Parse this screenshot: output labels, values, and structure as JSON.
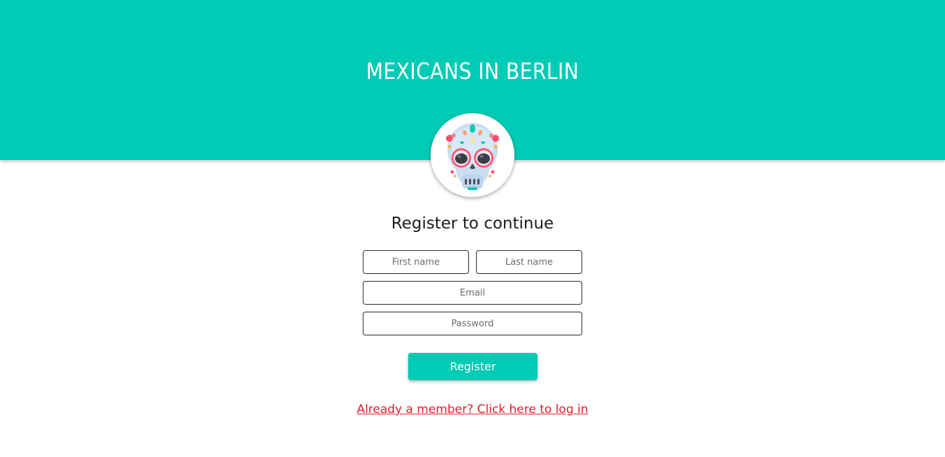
{
  "header": {
    "title": "MEXICANS IN BERLIN",
    "background": "#00cbb5"
  },
  "avatar": {
    "icon": "sugar-skull-icon"
  },
  "form": {
    "title": "Register to continue",
    "first_name": {
      "placeholder": "First name",
      "value": ""
    },
    "last_name": {
      "placeholder": "Last name",
      "value": ""
    },
    "email": {
      "placeholder": "Email",
      "value": ""
    },
    "password": {
      "placeholder": "Password",
      "value": ""
    },
    "submit_label": "Register",
    "login_link": "Already a member? Click here to log in"
  },
  "colors": {
    "accent": "#00cbb5",
    "link": "#e51c2c"
  }
}
